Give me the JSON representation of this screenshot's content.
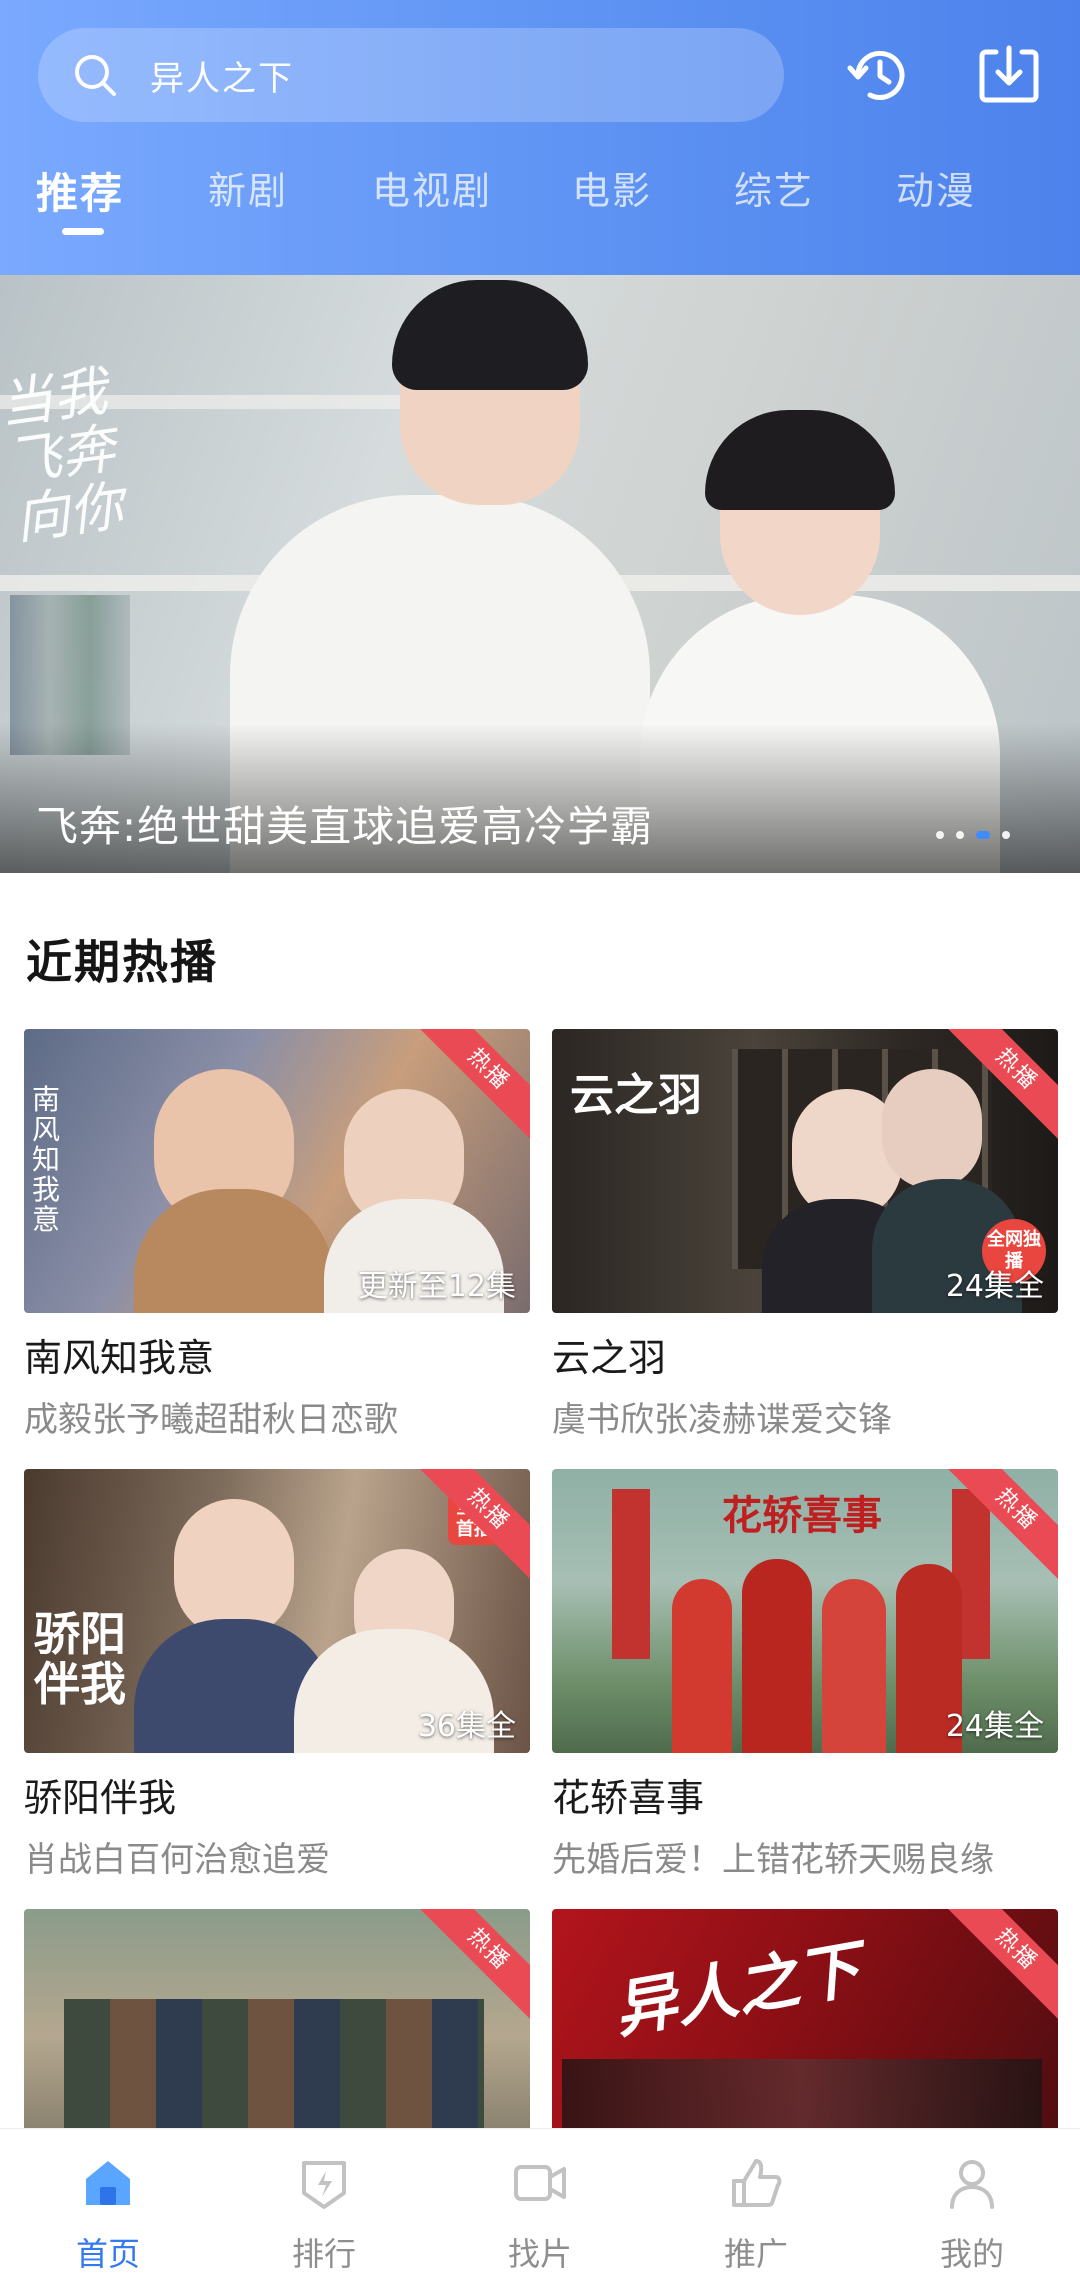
{
  "header": {
    "search_placeholder": "异人之下",
    "tabs": [
      {
        "label": "推荐"
      },
      {
        "label": "新剧"
      },
      {
        "label": "电视剧"
      },
      {
        "label": "电影"
      },
      {
        "label": "综艺"
      },
      {
        "label": "动漫"
      }
    ],
    "active_tab": "推荐",
    "icons": [
      "search-icon",
      "history-icon",
      "download-icon"
    ]
  },
  "banner": {
    "caption": "飞奔:绝世甜美直球追爱高冷学霸",
    "calligraphy": "当我飞奔向你",
    "indicator": {
      "count": 4,
      "active_index": 2
    }
  },
  "recent": {
    "title": "近期热播",
    "badge_label": "热播",
    "cards": [
      {
        "title": "南风知我意",
        "subtitle": "成毅张予曦超甜秋日恋歌",
        "episodes": "更新至12集",
        "poster_text": "南风知我意"
      },
      {
        "title": "云之羽",
        "subtitle": "虞书欣张凌赫谍爱交锋",
        "episodes": "24集全",
        "poster_text": "云之羽",
        "sticker": "全网独播"
      },
      {
        "title": "骄阳伴我",
        "subtitle": "肖战白百何治愈追爱",
        "episodes": "36集全",
        "poster_text": "骄阳伴我",
        "sticker": "全网首播"
      },
      {
        "title": "花轿喜事",
        "subtitle": "先婚后爱！上错花轿天赐良缘",
        "episodes": "24集全",
        "poster_text": "花轿喜事"
      },
      {
        "title": "",
        "subtitle": "",
        "episodes": "",
        "poster_text": ""
      },
      {
        "title": "",
        "subtitle": "",
        "episodes": "",
        "poster_text": "异人之下"
      }
    ]
  },
  "bottom_nav": [
    {
      "label": "首页",
      "icon": "home-icon",
      "active": true
    },
    {
      "label": "排行",
      "icon": "ranking-icon",
      "active": false
    },
    {
      "label": "找片",
      "icon": "video-icon",
      "active": false
    },
    {
      "label": "推广",
      "icon": "thumbs-up-icon",
      "active": false
    },
    {
      "label": "我的",
      "icon": "user-icon",
      "active": false
    }
  ],
  "colors": {
    "header_gradient_start": "#7aa9ff",
    "header_gradient_end": "#4d82ec",
    "accent": "#3579f0",
    "badge": "#ea4a54",
    "indicator_active": "#3f8cff"
  }
}
